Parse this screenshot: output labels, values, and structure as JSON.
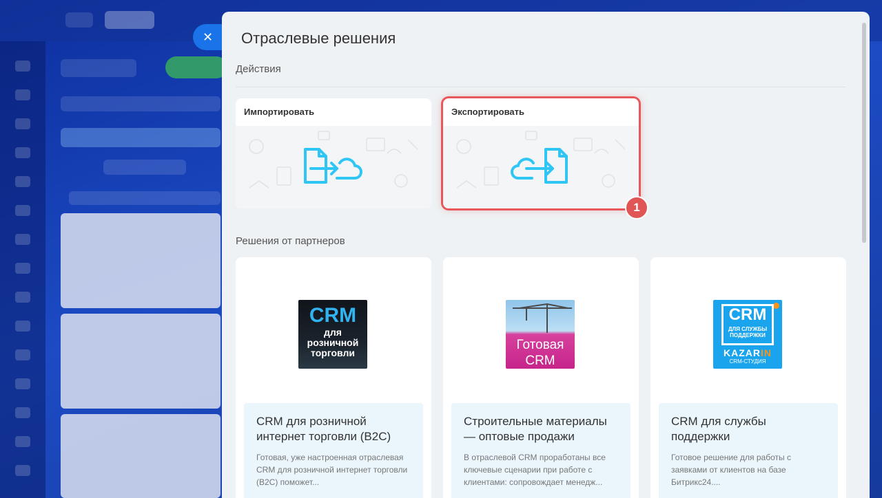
{
  "panel": {
    "title": "Отраслевые решения"
  },
  "actions": {
    "section_title": "Действия",
    "import_label": "Импортировать",
    "export_label": "Экспортировать",
    "step_badge": "1"
  },
  "partners": {
    "section_title": "Решения от партнеров",
    "items": [
      {
        "logo_text": "CRM",
        "logo_sub": "для розничной торговли",
        "title": "CRM для розничной интернет торговли (B2C)",
        "description": "Готовая, уже настроенная отраслевая CRM для розничной интернет торговли (B2C) поможет..."
      },
      {
        "logo_text": "Готовая CRM",
        "title": "Строительные материалы — оптовые продажи",
        "description": "В отраслевой CRM проработаны все ключевые сценарии при работе с клиентами: сопровождает менедж..."
      },
      {
        "logo_text": "CRM",
        "logo_sub": "ДЛЯ СЛУЖБЫ ПОДДЕРЖКИ",
        "logo_brand": "KAZAR",
        "logo_brand_accent": "IN",
        "logo_studio": "CRM-СТУДИЯ",
        "title": "CRM для службы поддержки",
        "description": "Готовое решение для работы с заявками от клиентов на базе Битрикс24...."
      }
    ]
  },
  "colors": {
    "accent": "#1a73e8",
    "highlight": "#e8585a",
    "icon": "#2fc6f6"
  },
  "icons": {
    "close": "close-icon",
    "import": "file-to-cloud-icon",
    "export": "cloud-to-file-icon"
  }
}
